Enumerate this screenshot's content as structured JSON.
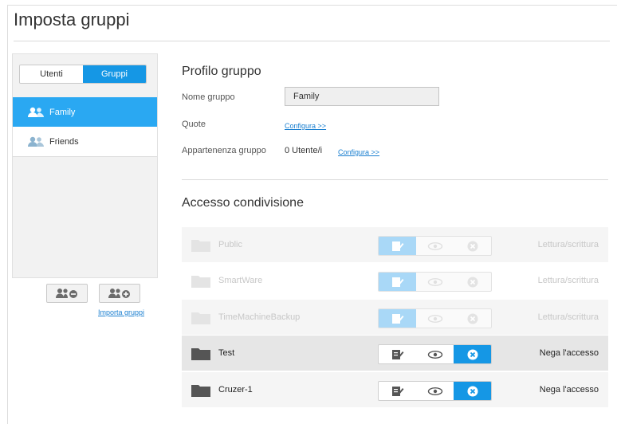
{
  "page": {
    "title": "Imposta gruppi"
  },
  "left": {
    "tabs": {
      "users": "Utenti",
      "groups": "Gruppi"
    },
    "groups": [
      {
        "name": "Family",
        "active": true
      },
      {
        "name": "Friends",
        "active": false
      }
    ],
    "remove_group_icon": "group-remove-icon",
    "add_group_icon": "group-add-icon",
    "import_link": "Importa gruppi"
  },
  "profile": {
    "title": "Profilo gruppo",
    "name_label": "Nome gruppo",
    "name_value": "Family",
    "quota_label": "Quote",
    "quota_link": "Configura >>",
    "membership_label": "Appartenenza gruppo",
    "membership_value": "0 Utente/i",
    "membership_link": "Configura >>"
  },
  "share_access": {
    "title": "Accesso condivisione",
    "shares": [
      {
        "name": "Public",
        "access": "Lettura/scrittura",
        "enabled": false
      },
      {
        "name": "SmartWare",
        "access": "Lettura/scrittura",
        "enabled": false
      },
      {
        "name": "TimeMachineBackup",
        "access": "Lettura/scrittura",
        "enabled": false
      },
      {
        "name": "Test",
        "access": "Nega l'accesso",
        "enabled": true
      },
      {
        "name": "Cruzer-1",
        "access": "Nega l'accesso",
        "enabled": true
      }
    ]
  },
  "colors": {
    "accent": "#1597e5",
    "active_item": "#2aa8f2",
    "link": "#1a7fd0"
  }
}
